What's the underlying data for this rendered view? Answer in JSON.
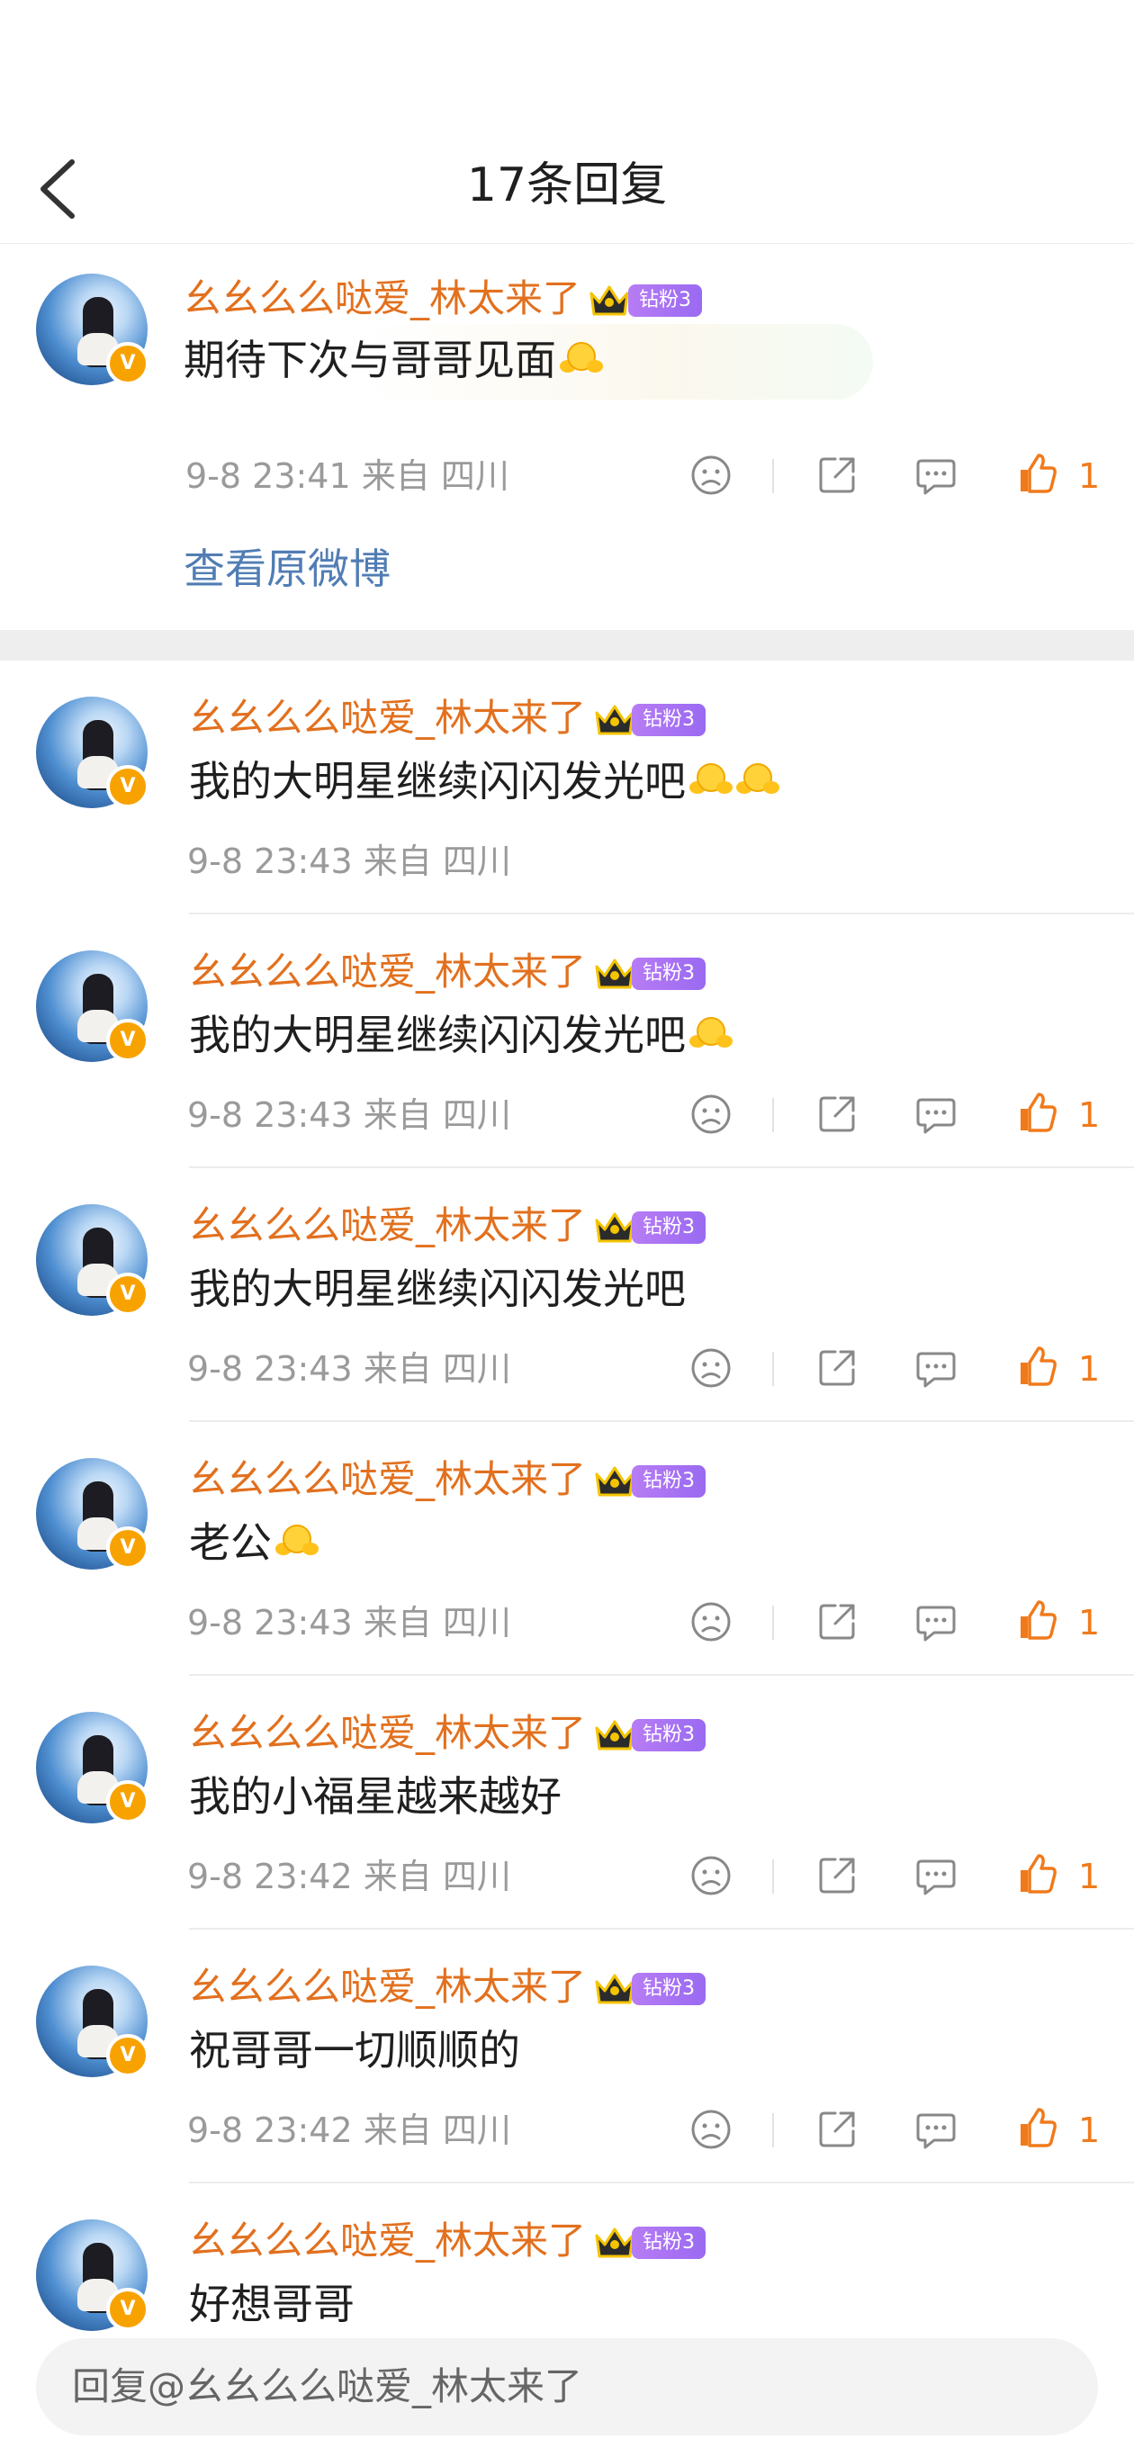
{
  "header": {
    "title": "17条回复"
  },
  "root_comment": {
    "username": "幺幺么么哒爱_林太来了",
    "fan_badge": "钻粉3",
    "text": "期待下次与哥哥见面",
    "time": "9-8 23:41",
    "location": "来自 四川",
    "likes": "1",
    "view_original": "查看原微博"
  },
  "replies": [
    {
      "username": "幺幺么么哒爱_林太来了",
      "fan_badge": "钻粉3",
      "text": "我的大明星继续闪闪发光吧",
      "time": "9-8 23:43",
      "location": "来自 四川",
      "likes": ""
    },
    {
      "username": "幺幺么么哒爱_林太来了",
      "fan_badge": "钻粉3",
      "text": "我的大明星继续闪闪发光吧",
      "time": "9-8 23:43",
      "location": "来自 四川",
      "likes": "1"
    },
    {
      "username": "幺幺么么哒爱_林太来了",
      "fan_badge": "钻粉3",
      "text": "我的大明星继续闪闪发光吧",
      "time": "9-8 23:43",
      "location": "来自 四川",
      "likes": "1"
    },
    {
      "username": "幺幺么么哒爱_林太来了",
      "fan_badge": "钻粉3",
      "text": "老公",
      "time": "9-8 23:43",
      "location": "来自 四川",
      "likes": "1"
    },
    {
      "username": "幺幺么么哒爱_林太来了",
      "fan_badge": "钻粉3",
      "text": "我的小福星越来越好",
      "time": "9-8 23:42",
      "location": "来自 四川",
      "likes": "1"
    },
    {
      "username": "幺幺么么哒爱_林太来了",
      "fan_badge": "钻粉3",
      "text": "祝哥哥一切顺顺的",
      "time": "9-8 23:42",
      "location": "来自 四川",
      "likes": "1"
    },
    {
      "username": "幺幺么么哒爱_林太来了",
      "fan_badge": "钻粉3",
      "text": "好想哥哥",
      "time": "",
      "location": "",
      "likes": ""
    }
  ],
  "reply_bar": {
    "placeholder": "回复@幺幺么么哒爱_林太来了"
  },
  "icons": {
    "back": "chevron-left-icon",
    "dislike": "frown-icon",
    "share": "share-icon",
    "comment": "comment-icon",
    "like": "thumbs-up-icon",
    "crown": "crown-icon",
    "verified": "verified-v-icon"
  },
  "colors": {
    "username": "#e2701e",
    "link": "#517db4",
    "like": "#f07a1b",
    "fan_badge": "#a56ff3",
    "verified": "#f8a200"
  }
}
